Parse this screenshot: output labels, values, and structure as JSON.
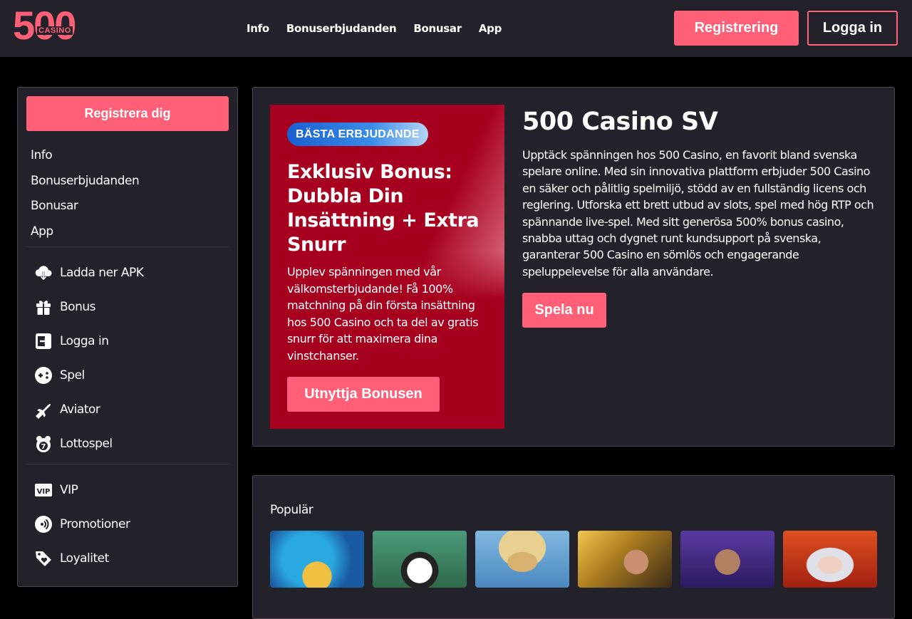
{
  "header": {
    "logo_big": "500",
    "logo_small": "CASINO",
    "nav": [
      "Info",
      "Bonuserbjudanden",
      "Bonusar",
      "App"
    ],
    "register_label": "Registrering",
    "login_label": "Logga in"
  },
  "sidebar": {
    "register_label": "Registrera dig",
    "links": [
      "Info",
      "Bonuserbjudanden",
      "Bonusar",
      "App"
    ],
    "menu": [
      {
        "label": "Ladda ner APK",
        "icon": "download-cloud-icon"
      },
      {
        "label": "Bonus",
        "icon": "gift-icon"
      },
      {
        "label": "Logga in",
        "icon": "login-icon"
      },
      {
        "label": "Spel",
        "icon": "gamepad-icon"
      },
      {
        "label": "Aviator",
        "icon": "plane-icon"
      },
      {
        "label": "Lottospel",
        "icon": "lottery-icon"
      }
    ],
    "menu2": [
      {
        "label": "VIP",
        "icon": "vip-icon"
      },
      {
        "label": "Promotioner",
        "icon": "promotion-icon"
      },
      {
        "label": "Loyalitet",
        "icon": "loyalty-tag-icon"
      }
    ]
  },
  "promo": {
    "badge": "BÄSTA ERBJUDANDE",
    "title": "Exklusiv Bonus: Dubbla Din Insättning + Extra Snurr",
    "text": "Upplev spänningen med vår välkomsterbjudande! Få 100% matchning på din första insättning hos 500 Casino och ta del av gratis snurr för att maximera dina vinstchanser.",
    "button": "Utnyttja Bonusen"
  },
  "hero": {
    "title": "500 Casino SV",
    "text": "Upptäck spänningen hos 500 Casino, en favorit bland svenska spelare online. Med sin innovativa plattform erbjuder 500 Casino en säker och pålitlig spelmiljö, stödd av en fullständig licens och reglering. Utforska ett brett utbud av slots, spel med hög RTP och spännande live-spel. Med sitt generösa 500% bonus casino, snabba uttag och dygnet runt kundsupport på svenska, garanterar 500 Casino en sömlös och engagerande speluppelevelse för alla användare.",
    "button": "Spela nu"
  },
  "popular": {
    "title": "Populär"
  },
  "colors": {
    "accent": "#ff6078",
    "panel": "#23212a",
    "promo": "#a6001e"
  }
}
